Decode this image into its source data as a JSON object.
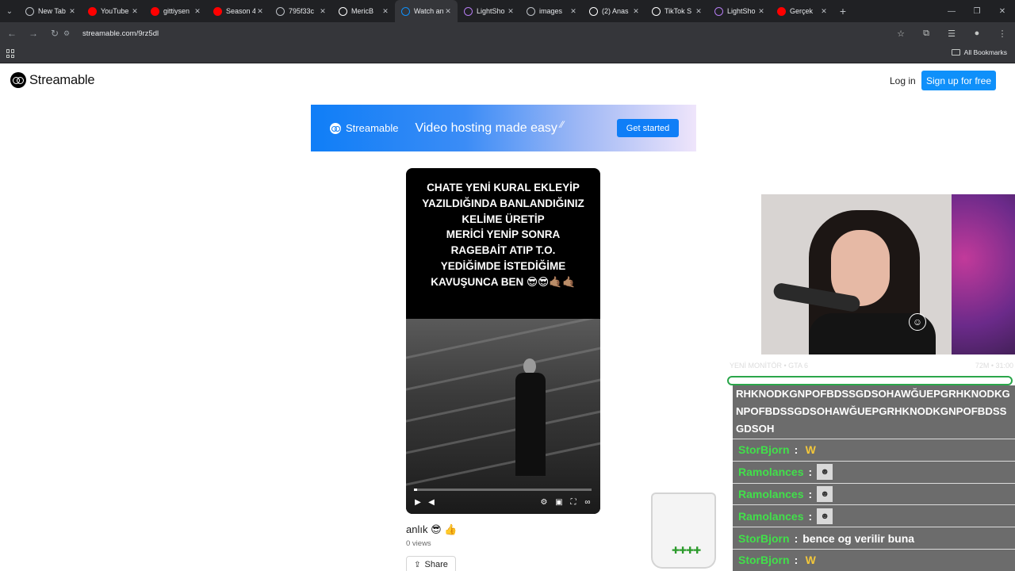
{
  "browser": {
    "tabs": [
      {
        "label": "New Tab",
        "icon": "chrome-icon",
        "color": "#bdc1c6",
        "active": false
      },
      {
        "label": "YouTube",
        "icon": "youtube-icon",
        "color": "#ff0000",
        "active": false
      },
      {
        "label": "gittiysen",
        "icon": "youtube-icon",
        "color": "#ff0000",
        "active": false
      },
      {
        "label": "Season 4",
        "icon": "youtube-icon",
        "color": "#ff0000",
        "active": false
      },
      {
        "label": "795f33c",
        "icon": "globe-icon",
        "color": "#bdc1c6",
        "active": false
      },
      {
        "label": "MericB",
        "icon": "tiktok-icon",
        "color": "#ffffff",
        "active": false
      },
      {
        "label": "Watch an",
        "icon": "streamable-icon",
        "color": "#0f90fa",
        "active": true
      },
      {
        "label": "LightSho",
        "icon": "lightshot-icon",
        "color": "#b47cf0",
        "active": false
      },
      {
        "label": "images",
        "icon": "globe-icon",
        "color": "#bdc1c6",
        "active": false
      },
      {
        "label": "(2) Anas",
        "icon": "x-icon",
        "color": "#ffffff",
        "active": false
      },
      {
        "label": "TikTok S",
        "icon": "tiktok-icon",
        "color": "#ffffff",
        "active": false
      },
      {
        "label": "LightSho",
        "icon": "lightshot-icon",
        "color": "#b47cf0",
        "active": false
      },
      {
        "label": "Gerçek",
        "icon": "youtube-icon",
        "color": "#ff0000",
        "active": false
      }
    ],
    "url": "streamable.com/9rz5dl",
    "bookmarks_label": "All Bookmarks"
  },
  "header": {
    "logo_text": "Streamable",
    "login_label": "Log in",
    "signup_label": "Sign up for free"
  },
  "banner": {
    "brand": "Streamable",
    "tagline": "Video hosting made easy",
    "cta": "Get started"
  },
  "video": {
    "caption": "CHATE YENİ KURAL EKLEYİP\nYAZILDIĞINDA BANLANDIĞINIZ\nKELİME ÜRETİP\nMERİCİ YENİP SONRA\nRAGEBAİT ATIP T.O.\nYEDİĞİMDE İSTEDİĞİME\nKAVUŞUNCA BEN 😎😎🤙🏽🤙🏽",
    "progress": 0.02,
    "title": "anlık 😎 👍",
    "views": "0 views",
    "share_label": "Share"
  },
  "stream": {
    "title": "YENİ MONİTÖR • GTA 6",
    "stats": "72M • 31:00"
  },
  "chat": {
    "spam_text": "RHKNODKGNPOFBDSSGDSOHAWĞUEPGRHKNODKGNPOFBDSSGDSOHAWĞUEPGRHKNODKGNPOFBDSSGDSOH",
    "messages": [
      {
        "user": "StorBjorn",
        "text": "",
        "emote": "W"
      },
      {
        "user": "Ramolances",
        "text": "",
        "emote": "pic"
      },
      {
        "user": "Ramolances",
        "text": "",
        "emote": "pic"
      },
      {
        "user": "Ramolances",
        "text": "",
        "emote": "pic"
      },
      {
        "user": "StorBjorn",
        "text": "bence og verilir buna",
        "emote": ""
      },
      {
        "user": "StorBjorn",
        "text": "",
        "emote": "W"
      }
    ],
    "user_color": "#41e04a"
  }
}
